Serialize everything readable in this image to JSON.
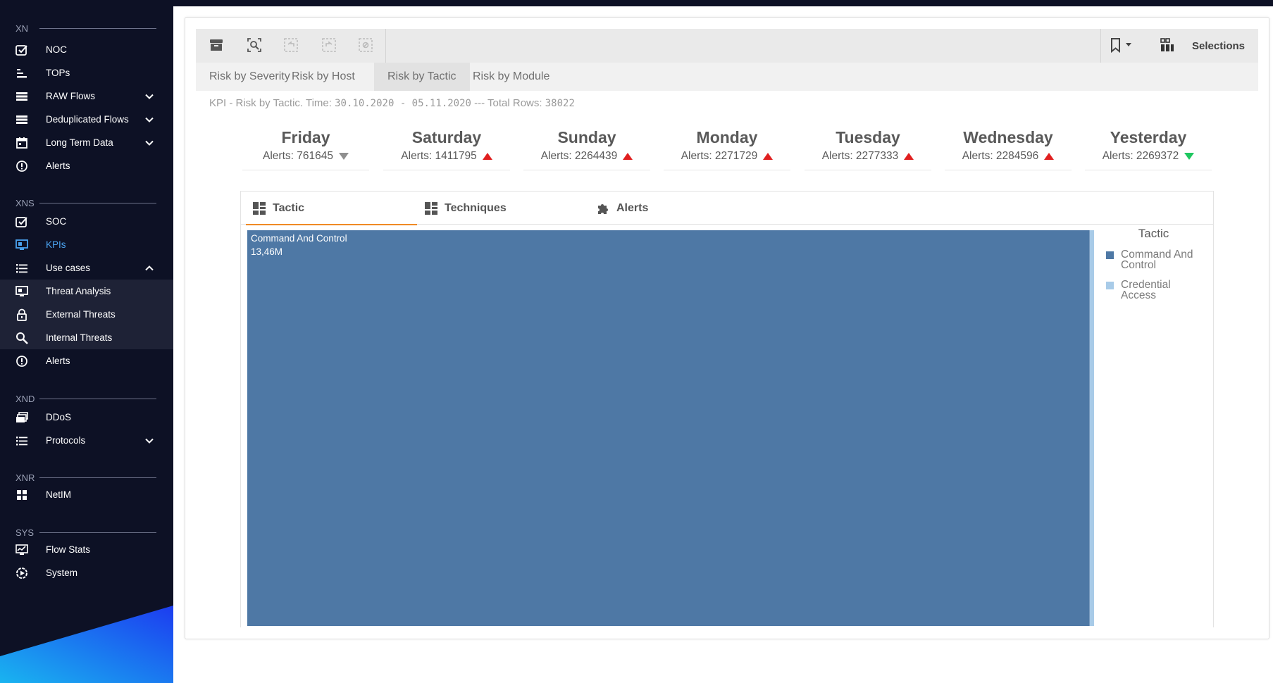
{
  "sidebar": {
    "sections": [
      {
        "label": "XN"
      },
      {
        "label": "XNS"
      },
      {
        "label": "XND"
      },
      {
        "label": "XNR"
      },
      {
        "label": "SYS"
      }
    ],
    "items": [
      {
        "label": "NOC",
        "icon": "dashboard-icon"
      },
      {
        "label": "TOPs",
        "icon": "bar-list-icon"
      },
      {
        "label": "RAW Flows",
        "icon": "list-icon"
      },
      {
        "label": "Deduplicated Flows",
        "icon": "list-icon"
      },
      {
        "label": "Long Term Data",
        "icon": "calendar-icon"
      },
      {
        "label": "Alerts",
        "icon": "alert-circle-icon"
      },
      {
        "label": "SOC",
        "icon": "dashboard-icon"
      },
      {
        "label": "KPIs",
        "icon": "monitor-icon"
      },
      {
        "label": "Use cases",
        "icon": "bullet-list-icon"
      },
      {
        "label": "Threat Analysis",
        "icon": "monitor-icon"
      },
      {
        "label": "External Threats",
        "icon": "lock-icon"
      },
      {
        "label": "Internal Threats",
        "icon": "search-icon"
      },
      {
        "label": "Alerts",
        "icon": "alert-circle-icon"
      },
      {
        "label": "DDoS",
        "icon": "stack-icon"
      },
      {
        "label": "Protocols",
        "icon": "bullet-list-icon"
      },
      {
        "label": "NetIM",
        "icon": "grid-icon"
      },
      {
        "label": "Flow Stats",
        "icon": "chart-monitor-icon"
      },
      {
        "label": "System",
        "icon": "play-gear-icon"
      }
    ]
  },
  "toolbar": {
    "selections_label": "Selections"
  },
  "sheet_tabs": [
    "Risk by Severity",
    "Risk by Host",
    "Risk by Tactic",
    "Risk by Module"
  ],
  "active_sheet_tab": "Risk by Tactic",
  "kpi_header": {
    "prefix": "KPI - Risk by Tactic. Time: ",
    "time_range": "30.10.2020 - 05.11.2020",
    "middle": " --- Total Rows: ",
    "total_rows": "38022"
  },
  "kpis": [
    {
      "day": "Friday",
      "alerts": "Alerts: 761645",
      "trend": "neutral"
    },
    {
      "day": "Saturday",
      "alerts": "Alerts: 1411795",
      "trend": "up"
    },
    {
      "day": "Sunday",
      "alerts": "Alerts: 2264439",
      "trend": "up"
    },
    {
      "day": "Monday",
      "alerts": "Alerts: 2271729",
      "trend": "up"
    },
    {
      "day": "Tuesday",
      "alerts": "Alerts: 2277333",
      "trend": "up"
    },
    {
      "day": "Wednesday",
      "alerts": "Alerts: 2284596",
      "trend": "up"
    },
    {
      "day": "Yesterday",
      "alerts": "Alerts: 2269372",
      "trend": "down"
    }
  ],
  "chart_tabs": [
    {
      "label": "Tactic",
      "icon": "treemap-icon"
    },
    {
      "label": "Techniques",
      "icon": "treemap-icon"
    },
    {
      "label": "Alerts",
      "icon": "puzzle-icon"
    }
  ],
  "chart_data": {
    "type": "treemap",
    "legend_title": "Tactic",
    "series": [
      {
        "name": "Command And Control",
        "value": 13460000,
        "label": "Command And Control",
        "value_label": "13,46M",
        "color": "#4e78a5"
      },
      {
        "name": "Credential Access",
        "value": 70000,
        "label": "",
        "value_label": "",
        "color": "#a8cbe8"
      }
    ]
  },
  "colors": {
    "sidebar_bg": "#0d1125",
    "accent_blue": "#4aa3f0",
    "tab_underline": "#f08a24",
    "trend_up": "#e02020",
    "trend_down": "#1fc760"
  }
}
